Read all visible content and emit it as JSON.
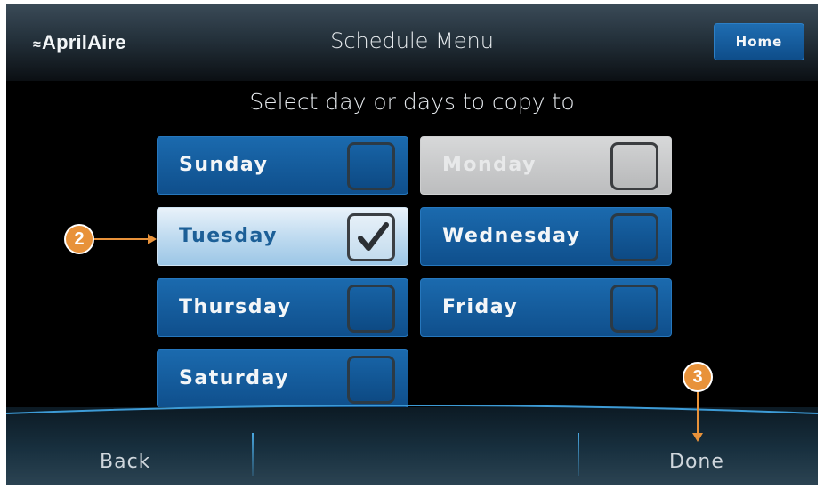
{
  "header": {
    "brand": "AprilAire",
    "brand_mark": "⥲",
    "title": "Schedule Menu",
    "home_label": "Home"
  },
  "subtitle": "Select day or days to copy to",
  "days": [
    {
      "label": "Sunday",
      "checked": false,
      "state": "normal"
    },
    {
      "label": "Monday",
      "checked": false,
      "state": "disabled"
    },
    {
      "label": "Tuesday",
      "checked": true,
      "state": "selected"
    },
    {
      "label": "Wednesday",
      "checked": false,
      "state": "normal"
    },
    {
      "label": "Thursday",
      "checked": false,
      "state": "normal"
    },
    {
      "label": "Friday",
      "checked": false,
      "state": "normal"
    },
    {
      "label": "Saturday",
      "checked": false,
      "state": "normal"
    }
  ],
  "footer": {
    "back_label": "Back",
    "done_label": "Done"
  },
  "callouts": [
    {
      "number": "2",
      "target": "Tuesday"
    },
    {
      "number": "3",
      "target": "Done"
    }
  ],
  "colors": {
    "accent_blue": "#1b6aae",
    "callout_orange": "#e8923a",
    "background": "#000000"
  }
}
